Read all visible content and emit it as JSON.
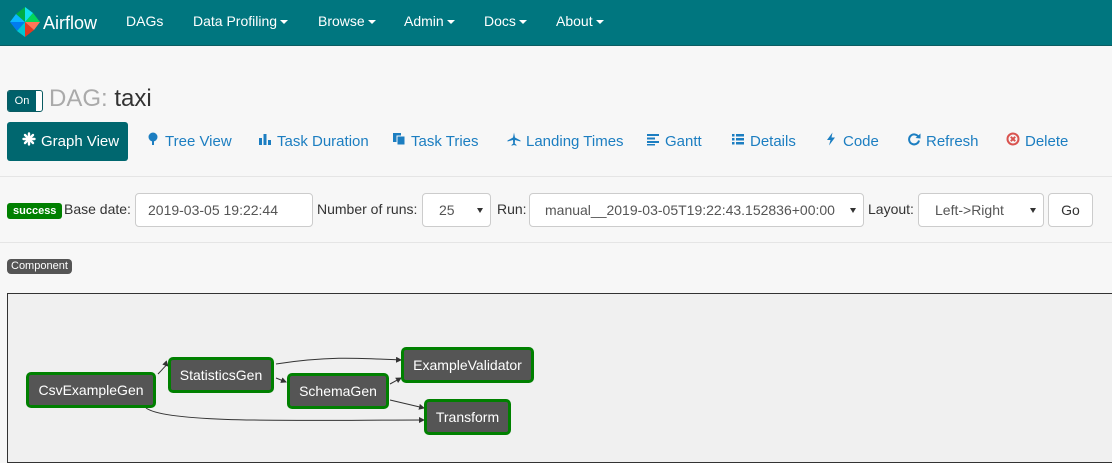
{
  "brand": {
    "name": "Airflow",
    "logo_icon": "pinwheel-logo-icon"
  },
  "nav": {
    "items": [
      {
        "label": "DAGs"
      },
      {
        "label": "Data Profiling"
      },
      {
        "label": "Browse"
      },
      {
        "label": "Admin"
      },
      {
        "label": "Docs"
      },
      {
        "label": "About"
      }
    ]
  },
  "dag": {
    "toggle_label": "On",
    "prefix": "DAG:",
    "id": "taxi"
  },
  "tabs": [
    {
      "label": "Graph View",
      "icon": "asterisk-icon"
    },
    {
      "label": "Tree View",
      "icon": "tree-icon"
    },
    {
      "label": "Task Duration",
      "icon": "bar-chart-icon"
    },
    {
      "label": "Task Tries",
      "icon": "duplicate-icon"
    },
    {
      "label": "Landing Times",
      "icon": "plane-icon"
    },
    {
      "label": "Gantt",
      "icon": "align-left-icon"
    },
    {
      "label": "Details",
      "icon": "list-icon"
    },
    {
      "label": "Code",
      "icon": "flash-icon"
    },
    {
      "label": "Refresh",
      "icon": "refresh-icon"
    },
    {
      "label": "Delete",
      "icon": "remove-circle-icon"
    }
  ],
  "form": {
    "state_badge": "success",
    "base_date_label": "Base date:",
    "base_date_value": "2019-03-05 19:22:44",
    "num_runs_label": "Number of runs:",
    "num_runs_value": "25",
    "run_label": "Run:",
    "run_value": "manual__2019-03-05T19:22:43.152836+00:00",
    "layout_label": "Layout:",
    "layout_value": "Left->Right",
    "go_label": "Go"
  },
  "legend": {
    "component_label": "Component"
  },
  "graph": {
    "nodes": [
      {
        "id": "csv",
        "label": "CsvExampleGen"
      },
      {
        "id": "stats",
        "label": "StatisticsGen"
      },
      {
        "id": "schema",
        "label": "SchemaGen"
      },
      {
        "id": "validator",
        "label": "ExampleValidator"
      },
      {
        "id": "transform",
        "label": "Transform"
      }
    ]
  },
  "colors": {
    "navbar": "#00767f",
    "active_tab": "#00676f",
    "link": "#1c7ec1",
    "success": "#008000",
    "node_fill": "#555555",
    "node_border": "#008000"
  }
}
